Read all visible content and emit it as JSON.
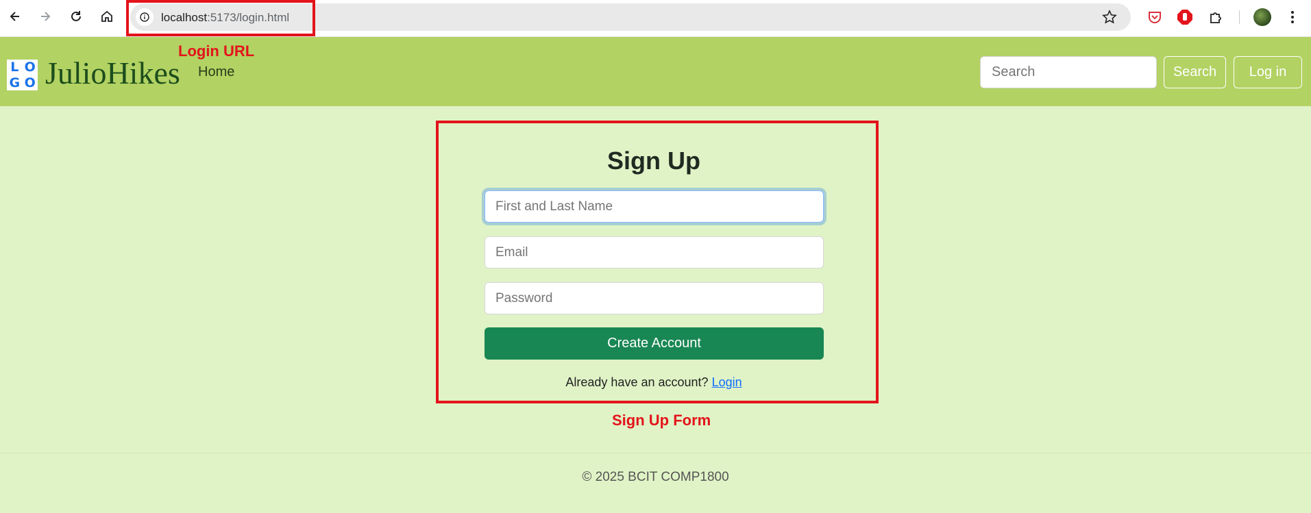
{
  "browser": {
    "url_host": "localhost",
    "url_path": ":5173/login.html"
  },
  "annotations": {
    "login_url": "Login URL",
    "signup_form": "Sign Up Form"
  },
  "navbar": {
    "logo_letters": [
      "L",
      "O",
      "G",
      "O"
    ],
    "brand": "JulioHikes",
    "home_link": "Home",
    "search_placeholder": "Search",
    "search_button": "Search",
    "login_button": "Log in"
  },
  "signup": {
    "title": "Sign Up",
    "name_placeholder": "First and Last Name",
    "email_placeholder": "Email",
    "password_placeholder": "Password",
    "submit": "Create Account",
    "already_text": "Already have an account?",
    "login_link": "Login"
  },
  "footer": {
    "text": "© 2025 BCIT COMP1800"
  },
  "colors": {
    "page_bg": "#e0f3c6",
    "navbar_bg": "#b2d263",
    "primary_green": "#198754",
    "annotation_red": "#e3141b",
    "link_blue": "#0d6efd"
  }
}
